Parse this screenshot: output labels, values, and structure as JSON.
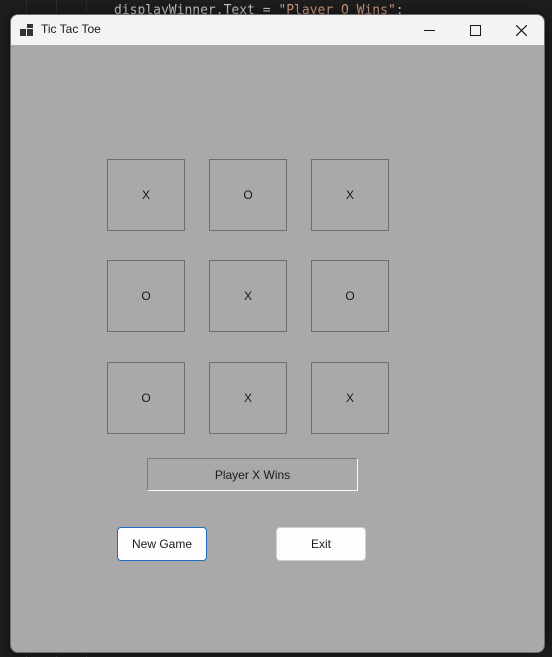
{
  "ide": {
    "code_prefix": "displayWinner.Text = ",
    "code_string": "\"Player O Wins\"",
    "code_suffix": ";"
  },
  "window": {
    "title": "Tic Tac Toe",
    "icons": {
      "app": "app-icon",
      "minimize": "minimize-icon",
      "maximize": "maximize-icon",
      "close": "close-icon"
    },
    "background_color": "#a9a9a9"
  },
  "board": {
    "cells": [
      [
        "X",
        "O",
        "X"
      ],
      [
        "O",
        "X",
        "O"
      ],
      [
        "O",
        "X",
        "X"
      ]
    ]
  },
  "status": {
    "text": "Player X Wins"
  },
  "buttons": {
    "new_game": "New Game",
    "exit": "Exit"
  },
  "colors": {
    "focus_border": "#1f6fc4",
    "titlebar": "#f3f3f3"
  }
}
